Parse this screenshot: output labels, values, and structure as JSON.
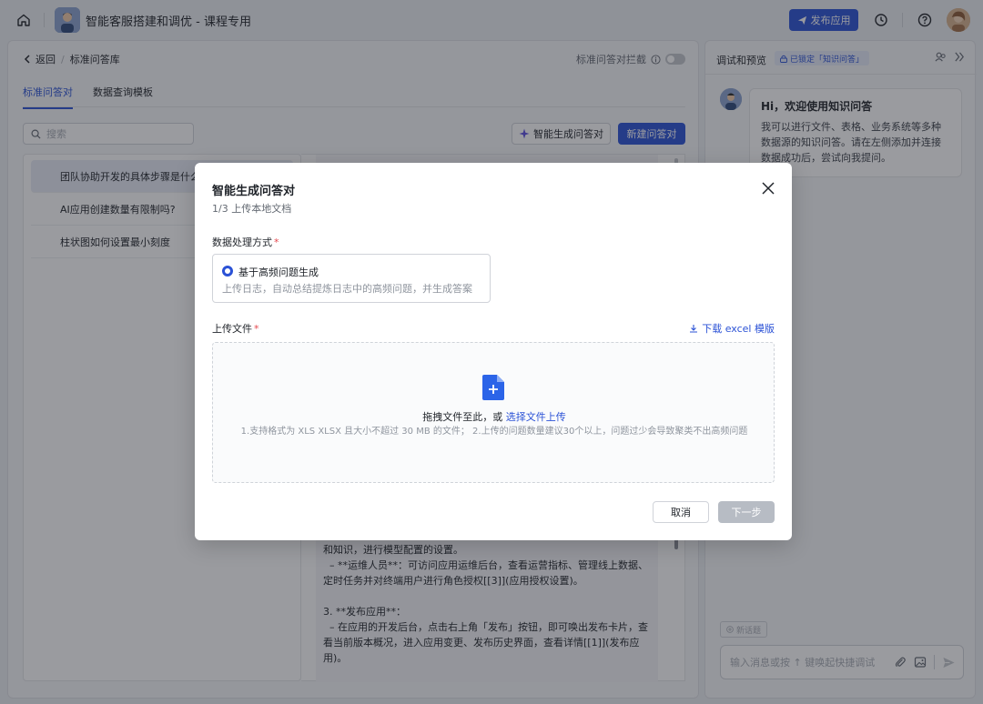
{
  "topbar": {
    "app_title": "智能客服搭建和调优 - 课程专用",
    "publish_label": "发布应用"
  },
  "left": {
    "back_label": "返回",
    "breadcrumb_current": "标准问答库",
    "block_toggle_label": "标准问答对拦截",
    "tabs": [
      {
        "label": "标准问答对"
      },
      {
        "label": "数据查询模板"
      }
    ],
    "search_placeholder": "搜索",
    "ai_generate_label": "智能生成问答对",
    "new_qa_label": "新建问答对",
    "questions": [
      {
        "label": "团队协助开发的具体步骤是什么?"
      },
      {
        "label": "AI应用创建数量有限制吗?"
      },
      {
        "label": "柱状图如何设置最小刻度"
      }
    ],
    "answer_text": "和知识，进行模型配置的设置。\n  – **运维人员**：可访问应用运维后台，查看运营指标、管理线上数据、定时任务并对终端用户进行角色授权[[3]](应用授权设置)。\n\n3. **发布应用**：\n  – 在应用的开发后台，点击右上角「发布」按钮，即可唤出发布卡片，查看当前版本概况，进入应用变更、发布历史界面，查看详情[[1]](发布应用)。"
  },
  "right": {
    "title": "调试和预览",
    "badge": "已锁定「知识问答」",
    "welcome_title": "Hi，欢迎使用知识问答",
    "welcome_text": "我可以进行文件、表格、业务系统等多种数据源的知识问答。请在左侧添加并连接数据成功后，尝试向我提问。",
    "new_topic_label": "新话题",
    "input_placeholder": "输入消息或按 ↑ 键唤起快捷调试"
  },
  "modal": {
    "title": "智能生成问答对",
    "step": "1/3 上传本地文档",
    "mode_label": "数据处理方式",
    "mode_option_title": "基于高频问题生成",
    "mode_option_desc": "上传日志，自动总结提炼日志中的高频问题，并生成答案",
    "upload_label": "上传文件",
    "download_template": "下载 excel 模版",
    "drop_text": "拖拽文件至此，或 ",
    "drop_link": "选择文件上传",
    "drop_hint": "1.支持格式为 XLS XLSX 且大小不超过 30 MB 的文件； 2.上传的问题数量建议30个以上，问题过少会导致聚类不出高频问题",
    "cancel_label": "取消",
    "next_label": "下一步"
  },
  "colors": {
    "accent": "#2b52d6",
    "required": "#e5484d",
    "disabled": "#b7bcc4"
  },
  "icons": [
    "home-icon",
    "send-plane-icon",
    "history-icon",
    "help-icon",
    "chevron-left-icon",
    "info-icon",
    "search-icon",
    "sparkle-icon",
    "lock-icon",
    "users-icon",
    "double-chevron-right-icon",
    "close-icon",
    "download-icon",
    "file-plus-icon",
    "attachment-icon",
    "image-icon",
    "send-icon"
  ]
}
